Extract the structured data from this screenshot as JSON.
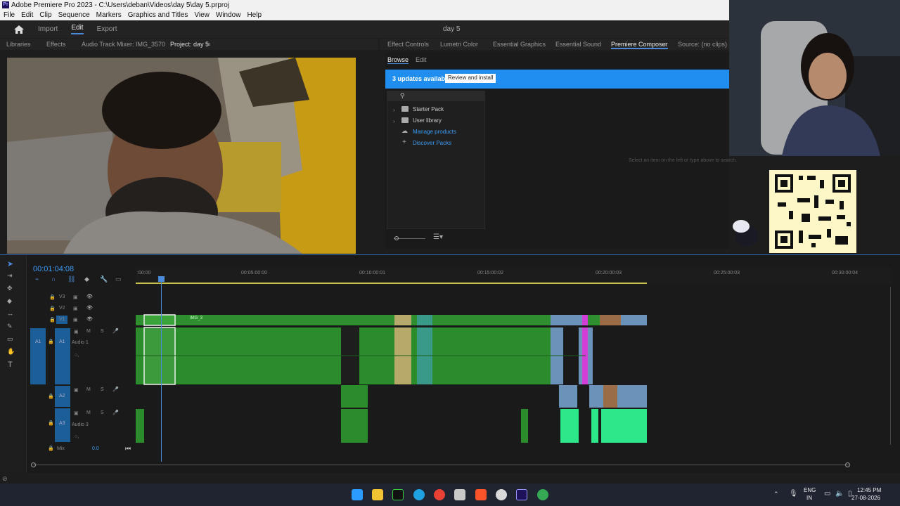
{
  "window": {
    "title": "Adobe Premiere Pro 2023 - C:\\Users\\deban\\Videos\\day 5\\day 5.prproj",
    "app_icon": "Pr"
  },
  "menu": [
    "File",
    "Edit",
    "Clip",
    "Sequence",
    "Markers",
    "Graphics and Titles",
    "View",
    "Window",
    "Help"
  ],
  "header": {
    "tabs": [
      {
        "label": "Import"
      },
      {
        "label": "Edit"
      },
      {
        "label": "Export"
      }
    ],
    "project_name": "day 5"
  },
  "left_panel": {
    "tabs": [
      "Libraries",
      "Effects",
      "Audio Track Mixer: IMG_3570",
      "Project: day 5"
    ]
  },
  "right_panel": {
    "tabs": [
      "Effect Controls",
      "Lumetri Color",
      "Essential Graphics",
      "Essential Sound",
      "Premiere Composer",
      "Source: (no clips)"
    ],
    "subtabs": [
      "Browse",
      "Edit"
    ],
    "banner_text": "3 updates available",
    "banner_button": "Review and install",
    "tree": [
      "Starter Pack",
      "User library",
      "Manage products",
      "Discover Packs"
    ],
    "empty_hint": "Select an item on the left or type above to search."
  },
  "timeline": {
    "timecode": "00:01:04:08",
    "ruler": [
      ":00:00",
      "00:05:00:00",
      "00:10:00:01",
      "00:15:00:02",
      "00:20:00:03",
      "00:25:00:03",
      "00:30:00:04"
    ],
    "video_tracks": [
      "V3",
      "V2",
      "V1"
    ],
    "audio_tracks": [
      "A1",
      "A2",
      "A3"
    ],
    "audio_names": {
      "a1": "Audio 1",
      "a3": "Audio 3"
    },
    "source_patch": "A1",
    "mix_label": "Mix",
    "mix_value": "0.0",
    "clip_label": "IMG_3"
  },
  "taskbar": {
    "lang": "ENG",
    "region": "IN",
    "time": "12:45 PM",
    "date": "27-08-2026"
  }
}
